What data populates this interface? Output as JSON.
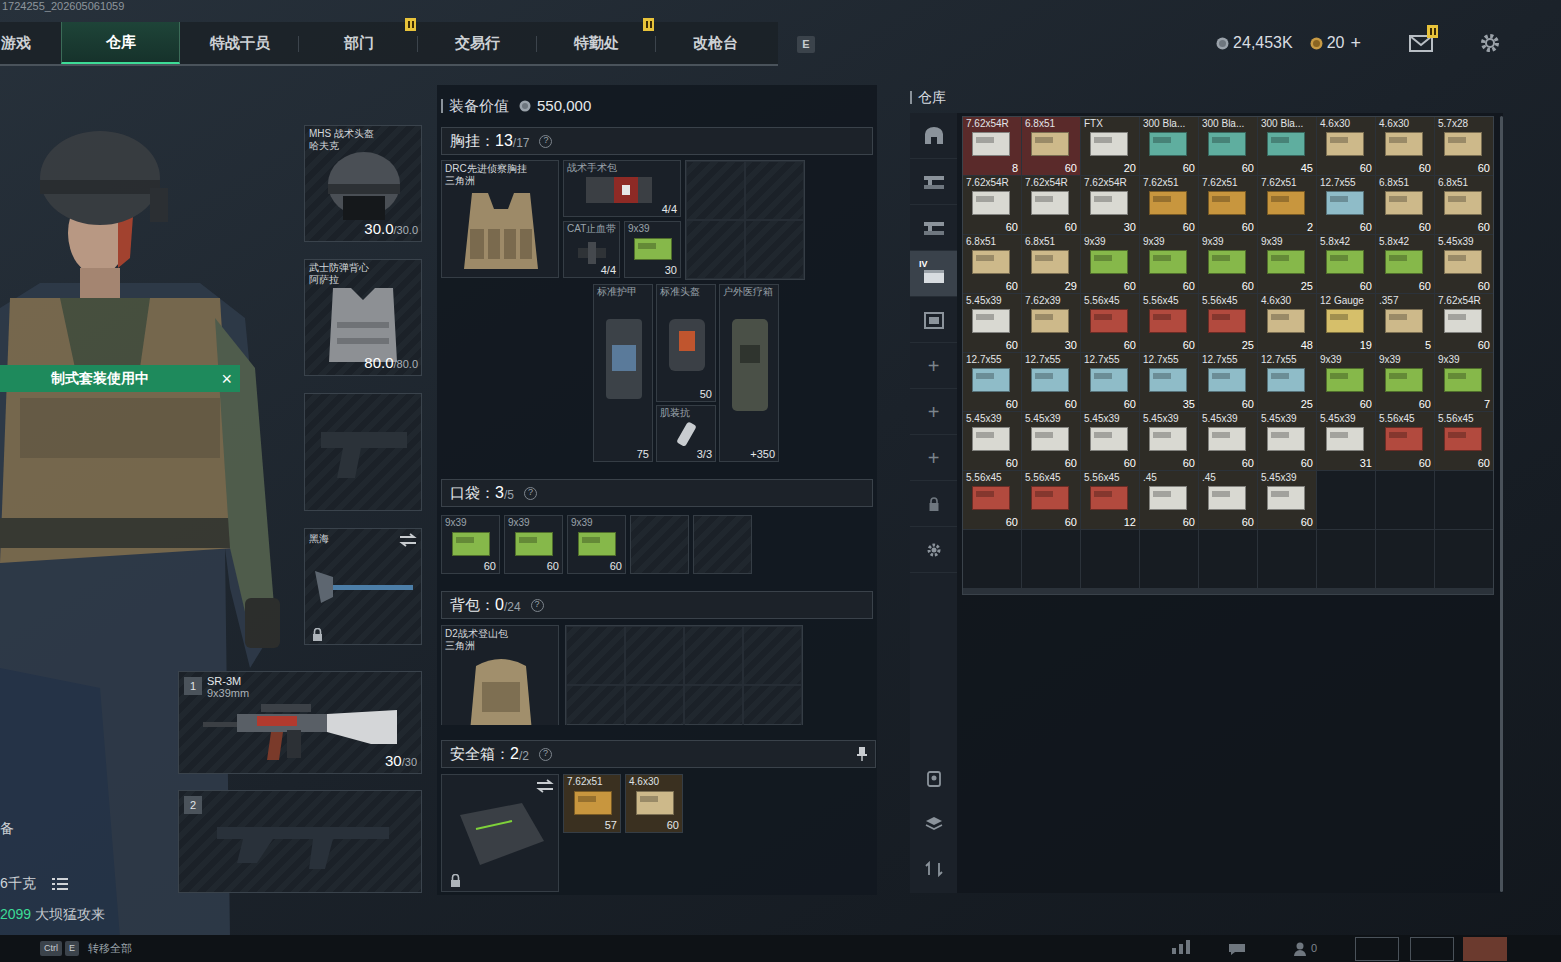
{
  "build_id": "1724255_202605061059",
  "tabs": [
    {
      "label": "游戏",
      "selected": false,
      "badge": false
    },
    {
      "label": "仓库",
      "selected": true,
      "badge": false
    },
    {
      "label": "特战干员",
      "selected": false,
      "badge": false
    },
    {
      "label": "部门",
      "selected": false,
      "badge": true
    },
    {
      "label": "交易行",
      "selected": false,
      "badge": false
    },
    {
      "label": "特勤处",
      "selected": false,
      "badge": true
    },
    {
      "label": "改枪台",
      "selected": false,
      "badge": false
    }
  ],
  "tab_hotkey": "E",
  "wallet": {
    "coins": "24,453K",
    "tokens": "20",
    "add": "+"
  },
  "mail": {
    "badge": true
  },
  "operator": {
    "preset_banner": "制式套装使用中",
    "banner_close": "×",
    "side_text": "备",
    "weight": "6千克",
    "event_code": "2099",
    "event_text": "大坝猛攻来"
  },
  "gear": {
    "helmet": {
      "name": "MHS 战术头盔",
      "maker": "哈夫克",
      "durability": "30.0",
      "max": "/30.0"
    },
    "armor": {
      "name": "武士防弹背心",
      "maker": "阿萨拉",
      "durability": "80.0",
      "max": "/80.0"
    },
    "pistol": {
      "empty": true
    },
    "melee": {
      "name": "黑海",
      "locked": true
    },
    "weapons": [
      {
        "slot": "1",
        "name": "SR-3M",
        "caliber": "9x39mm",
        "ammo": "30",
        "capacity": "/30",
        "empty": false
      },
      {
        "slot": "2",
        "name": "",
        "caliber": "",
        "ammo": "",
        "capacity": "",
        "empty": true
      }
    ]
  },
  "loadout": {
    "value_label": "装备价值",
    "value": "550,000",
    "chest": {
      "label": "胸挂：",
      "count": "13",
      "capacity": "/17",
      "help": "?",
      "rig": {
        "name": "DRC先进侦察胸挂",
        "maker": "三角洲"
      },
      "items": [
        {
          "name": "战术手术包",
          "count": "4/4"
        },
        {
          "name": "CAT止血带",
          "count": "4/4"
        },
        {
          "name": "9x39",
          "count": "30"
        },
        {
          "name": "标准护甲",
          "count": "75"
        },
        {
          "name": "标准头盔",
          "count": "50"
        },
        {
          "name": "肌装抗",
          "count": "3/3"
        },
        {
          "name": "户外医疗箱",
          "count": "+350"
        }
      ]
    },
    "pockets": {
      "label": "口袋：",
      "count": "3",
      "capacity": "/5",
      "help": "?",
      "slots": [
        {
          "name": "9x39",
          "count": "60",
          "empty": false
        },
        {
          "name": "9x39",
          "count": "60",
          "empty": false
        },
        {
          "name": "9x39",
          "count": "60",
          "empty": false
        },
        {
          "name": "",
          "count": "",
          "empty": true
        },
        {
          "name": "",
          "count": "",
          "empty": true
        }
      ]
    },
    "backpack": {
      "label": "背包：",
      "count": "0",
      "capacity": "/24",
      "help": "?",
      "bag": {
        "name": "D2战术登山包",
        "maker": "三角洲"
      }
    },
    "safe": {
      "label": "安全箱：",
      "count": "2",
      "capacity": "/2",
      "help": "?",
      "locked": true,
      "items": [
        {
          "name": "7.62x51",
          "count": "57",
          "color": "#c8963e"
        },
        {
          "name": "4.6x30",
          "count": "60",
          "color": "#cdb98a"
        }
      ]
    }
  },
  "stash": {
    "title": "仓库",
    "sidebar": [
      {
        "kind": "home",
        "label": "",
        "selected": false
      },
      {
        "kind": "guns",
        "label": "",
        "selected": false
      },
      {
        "kind": "guns",
        "label": "",
        "selected": false
      },
      {
        "kind": "crate",
        "label": "IV",
        "selected": true
      },
      {
        "kind": "box",
        "label": "",
        "selected": false
      },
      {
        "kind": "add",
        "label": "+",
        "selected": false
      },
      {
        "kind": "add",
        "label": "+",
        "selected": false
      },
      {
        "kind": "add",
        "label": "+",
        "selected": false
      },
      {
        "kind": "lock",
        "label": "",
        "selected": false
      },
      {
        "kind": "gear",
        "label": "",
        "selected": false
      }
    ],
    "sidebar_bottom": [
      {
        "kind": "tool"
      },
      {
        "kind": "layers"
      },
      {
        "kind": "sort"
      }
    ],
    "items": [
      {
        "label": "7.62x54R",
        "count": "8",
        "color": "#d9d9d2",
        "marked": true
      },
      {
        "label": "6.8x51",
        "count": "60",
        "color": "#cdb98a",
        "marked": true
      },
      {
        "label": "FTX",
        "count": "20",
        "color": "#d9d9d2",
        "marked": false
      },
      {
        "label": "300 Bla...",
        "count": "60",
        "color": "#5fae9f",
        "marked": false
      },
      {
        "label": "300 Bla...",
        "count": "60",
        "color": "#5fae9f",
        "marked": false
      },
      {
        "label": "300 Bla...",
        "count": "45",
        "color": "#5fae9f",
        "marked": false
      },
      {
        "label": "4.6x30",
        "count": "60",
        "color": "#cdb98a",
        "marked": false
      },
      {
        "label": "4.6x30",
        "count": "60",
        "color": "#cdb98a",
        "marked": false
      },
      {
        "label": "5.7x28",
        "count": "60",
        "color": "#cdb98a",
        "marked": false
      },
      {
        "label": "7.62x54R",
        "count": "60",
        "color": "#d9d9d2",
        "marked": false
      },
      {
        "label": "7.62x54R",
        "count": "60",
        "color": "#d9d9d2",
        "marked": false
      },
      {
        "label": "7.62x54R",
        "count": "30",
        "color": "#d9d9d2",
        "marked": false
      },
      {
        "label": "7.62x51",
        "count": "60",
        "color": "#c8963e",
        "marked": false
      },
      {
        "label": "7.62x51",
        "count": "60",
        "color": "#c8963e",
        "marked": false
      },
      {
        "label": "7.62x51",
        "count": "2",
        "color": "#c8963e",
        "marked": false
      },
      {
        "label": "12.7x55",
        "count": "60",
        "color": "#8fbcc8",
        "marked": false
      },
      {
        "label": "6.8x51",
        "count": "60",
        "color": "#cdb98a",
        "marked": false
      },
      {
        "label": "6.8x51",
        "count": "60",
        "color": "#cdb98a",
        "marked": false
      },
      {
        "label": "6.8x51",
        "count": "60",
        "color": "#cdb98a",
        "marked": false
      },
      {
        "label": "6.8x51",
        "count": "29",
        "color": "#cdb98a",
        "marked": false
      },
      {
        "label": "9x39",
        "count": "60",
        "color": "#86b84a",
        "marked": false
      },
      {
        "label": "9x39",
        "count": "60",
        "color": "#86b84a",
        "marked": false
      },
      {
        "label": "9x39",
        "count": "60",
        "color": "#86b84a",
        "marked": false
      },
      {
        "label": "9x39",
        "count": "25",
        "color": "#86b84a",
        "marked": false
      },
      {
        "label": "5.8x42",
        "count": "60",
        "color": "#86b84a",
        "marked": false
      },
      {
        "label": "5.8x42",
        "count": "60",
        "color": "#86b84a",
        "marked": false
      },
      {
        "label": "5.45x39",
        "count": "60",
        "color": "#cdb98a",
        "marked": false
      },
      {
        "label": "5.45x39",
        "count": "60",
        "color": "#d9d9d2",
        "marked": false
      },
      {
        "label": "7.62x39",
        "count": "30",
        "color": "#cdb98a",
        "marked": false
      },
      {
        "label": "5.56x45",
        "count": "60",
        "color": "#b24a3e",
        "marked": false
      },
      {
        "label": "5.56x45",
        "count": "60",
        "color": "#b24a3e",
        "marked": false
      },
      {
        "label": "5.56x45",
        "count": "25",
        "color": "#b24a3e",
        "marked": false
      },
      {
        "label": "4.6x30",
        "count": "48",
        "color": "#cdb98a",
        "marked": false
      },
      {
        "label": "12 Gauge",
        "count": "19",
        "color": "#d6bf6a",
        "marked": false
      },
      {
        "label": ".357",
        "count": "5",
        "color": "#cdb98a",
        "marked": false
      },
      {
        "label": "7.62x54R",
        "count": "60",
        "color": "#d9d9d2",
        "marked": false
      },
      {
        "label": "12.7x55",
        "count": "60",
        "color": "#8fbcc8",
        "marked": false
      },
      {
        "label": "12.7x55",
        "count": "60",
        "color": "#8fbcc8",
        "marked": false
      },
      {
        "label": "12.7x55",
        "count": "60",
        "color": "#8fbcc8",
        "marked": false
      },
      {
        "label": "12.7x55",
        "count": "35",
        "color": "#8fbcc8",
        "marked": false
      },
      {
        "label": "12.7x55",
        "count": "60",
        "color": "#8fbcc8",
        "marked": false
      },
      {
        "label": "12.7x55",
        "count": "25",
        "color": "#8fbcc8",
        "marked": false
      },
      {
        "label": "9x39",
        "count": "60",
        "color": "#86b84a",
        "marked": false
      },
      {
        "label": "9x39",
        "count": "60",
        "color": "#86b84a",
        "marked": false
      },
      {
        "label": "9x39",
        "count": "7",
        "color": "#86b84a",
        "marked": false
      },
      {
        "label": "5.45x39",
        "count": "60",
        "color": "#d9d9d2",
        "marked": false
      },
      {
        "label": "5.45x39",
        "count": "60",
        "color": "#d9d9d2",
        "marked": false
      },
      {
        "label": "5.45x39",
        "count": "60",
        "color": "#d9d9d2",
        "marked": false
      },
      {
        "label": "5.45x39",
        "count": "60",
        "color": "#d9d9d2",
        "marked": false
      },
      {
        "label": "5.45x39",
        "count": "60",
        "color": "#d9d9d2",
        "marked": false
      },
      {
        "label": "5.45x39",
        "count": "60",
        "color": "#d9d9d2",
        "marked": false
      },
      {
        "label": "5.45x39",
        "count": "31",
        "color": "#d9d9d2",
        "marked": false
      },
      {
        "label": "5.56x45",
        "count": "60",
        "color": "#b24a3e",
        "marked": false
      },
      {
        "label": "5.56x45",
        "count": "60",
        "color": "#b24a3e",
        "marked": false
      },
      {
        "label": "5.56x45",
        "count": "60",
        "color": "#b24a3e",
        "marked": false
      },
      {
        "label": "5.56x45",
        "count": "60",
        "color": "#b24a3e",
        "marked": false
      },
      {
        "label": "5.56x45",
        "count": "12",
        "color": "#b24a3e",
        "marked": false
      },
      {
        "label": ".45",
        "count": "60",
        "color": "#d9d9d2",
        "marked": false
      },
      {
        "label": ".45",
        "count": "60",
        "color": "#d9d9d2",
        "marked": false
      },
      {
        "label": "5.45x39",
        "count": "60",
        "color": "#d9d9d2",
        "marked": false
      }
    ]
  },
  "footer": {
    "keys": [
      "Ctrl",
      "E"
    ],
    "action": "转移全部",
    "friends": "0"
  }
}
